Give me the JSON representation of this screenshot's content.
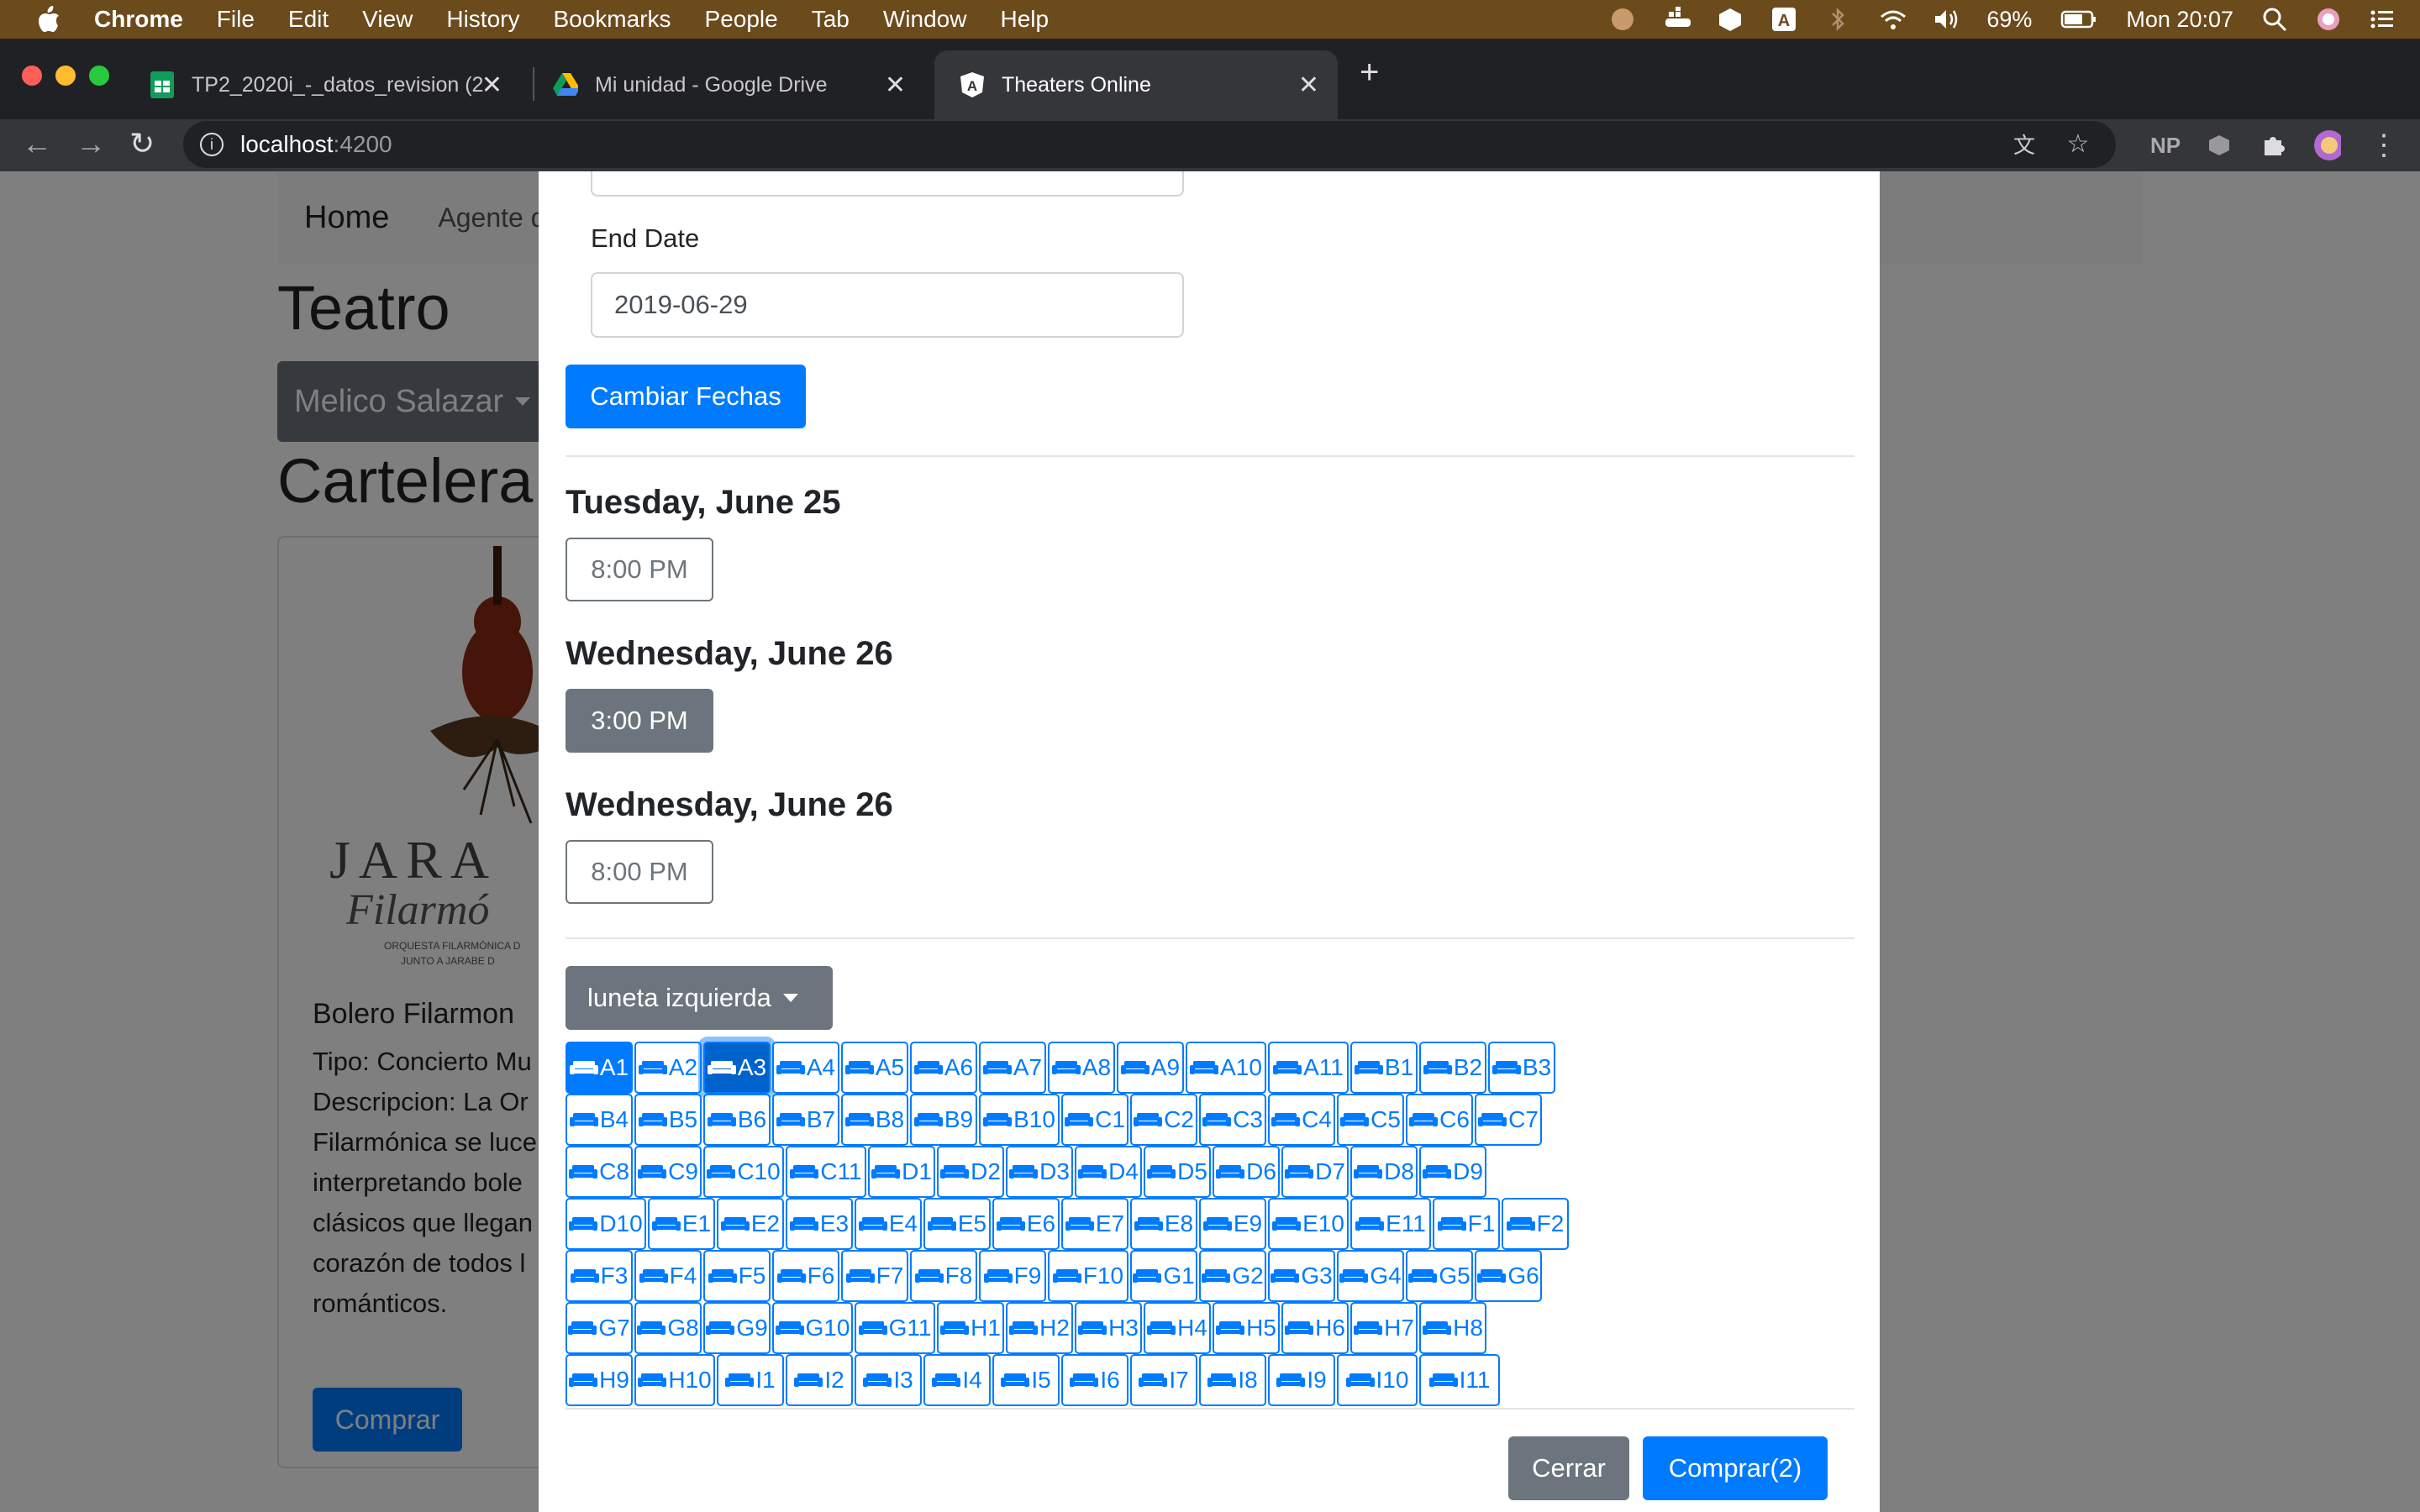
{
  "menubar": {
    "app": "Chrome",
    "items": [
      "File",
      "Edit",
      "View",
      "History",
      "Bookmarks",
      "People",
      "Tab",
      "Window",
      "Help"
    ],
    "battery": "69%",
    "clock": "Mon 20:07"
  },
  "tabs": [
    {
      "title": "TP2_2020i_-_datos_revision (2..",
      "favicon": "sheets-icon"
    },
    {
      "title": "Mi unidad - Google Drive",
      "favicon": "drive-icon"
    },
    {
      "title": "Theaters Online",
      "favicon": "angular-icon"
    }
  ],
  "address": {
    "host": "localhost",
    "port": ":4200"
  },
  "toolbar_extensions": {
    "np": "NP"
  },
  "background": {
    "nav_home": "Home",
    "nav_agent": "Agente d",
    "title_theatre": "Teatro",
    "theatre_select": "Melico Salazar",
    "title_billboard": "Cartelera",
    "card_title": "Bolero Filarmon",
    "card_lines": [
      "Tipo: Concierto Mu",
      "Descripcion: La Or",
      "Filarmónica se luce",
      "interpretando bole",
      "clásicos que llegan",
      "corazón de todos l",
      "románticos."
    ],
    "card_button": "Comprar",
    "poster_text": "JARA",
    "poster_script": "Filarmó",
    "poster_small": "ORQUESTA FILARMÓNICA D",
    "poster_small2": "JUNTO A JARABE D"
  },
  "modal": {
    "end_date_label": "End Date",
    "end_date_value": "2019-06-29",
    "change_dates_button": "Cambiar Fechas",
    "shows": [
      {
        "day": "Tuesday, June 25",
        "time": "8:00 PM",
        "active": false
      },
      {
        "day": "Wednesday, June 26",
        "time": "3:00 PM",
        "active": true
      },
      {
        "day": "Wednesday, June 26",
        "time": "8:00 PM",
        "active": false
      }
    ],
    "zone_select": "luneta izquierda",
    "seat_rows": [
      [
        "A1",
        "A2",
        "A3",
        "A4",
        "A5",
        "A6",
        "A7",
        "A8",
        "A9",
        "A10",
        "A11",
        "B1",
        "B2",
        "B3"
      ],
      [
        "B4",
        "B5",
        "B6",
        "B7",
        "B8",
        "B9",
        "B10",
        "C1",
        "C2",
        "C3",
        "C4",
        "C5",
        "C6",
        "C7"
      ],
      [
        "C8",
        "C9",
        "C10",
        "C11",
        "D1",
        "D2",
        "D3",
        "D4",
        "D5",
        "D6",
        "D7",
        "D8",
        "D9"
      ],
      [
        "D10",
        "E1",
        "E2",
        "E3",
        "E4",
        "E5",
        "E6",
        "E7",
        "E8",
        "E9",
        "E10",
        "E11",
        "F1",
        "F2"
      ],
      [
        "F3",
        "F4",
        "F5",
        "F6",
        "F7",
        "F8",
        "F9",
        "F10",
        "G1",
        "G2",
        "G3",
        "G4",
        "G5",
        "G6"
      ],
      [
        "G7",
        "G8",
        "G9",
        "G10",
        "G11",
        "H1",
        "H2",
        "H3",
        "H4",
        "H5",
        "H6",
        "H7",
        "H8"
      ],
      [
        "H9",
        "H10",
        "I1",
        "I2",
        "I3",
        "I4",
        "I5",
        "I6",
        "I7",
        "I8",
        "I9",
        "I10",
        "I11"
      ]
    ],
    "selected_seats": [
      "A1",
      "A3"
    ],
    "focused_seat": "A3",
    "close_button": "Cerrar",
    "buy_button": "Comprar(2)"
  },
  "colors": {
    "primary": "#007bff",
    "secondary": "#6c757d",
    "menubar": "#6b4a1c",
    "chrome_dark": "#202124"
  }
}
